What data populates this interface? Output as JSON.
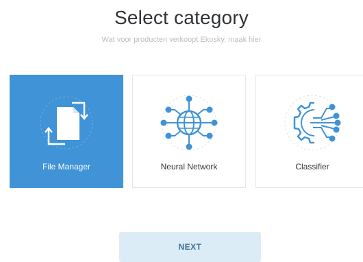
{
  "header": {
    "title": "Select category",
    "subtitle": "Wat voor producten verkoopt Ekosky, maak hier"
  },
  "categories": [
    {
      "label": "File Manager",
      "icon": "file-manager-icon",
      "selected": true
    },
    {
      "label": "Neural Network",
      "icon": "neural-network-icon",
      "selected": false
    },
    {
      "label": "Classifier",
      "icon": "classifier-icon",
      "selected": false
    }
  ],
  "actions": {
    "next_label": "NEXT"
  },
  "colors": {
    "accent": "#3f93d6",
    "button_bg": "#dcecf7",
    "title": "#2f3338",
    "subtitle": "#b9bec4"
  }
}
